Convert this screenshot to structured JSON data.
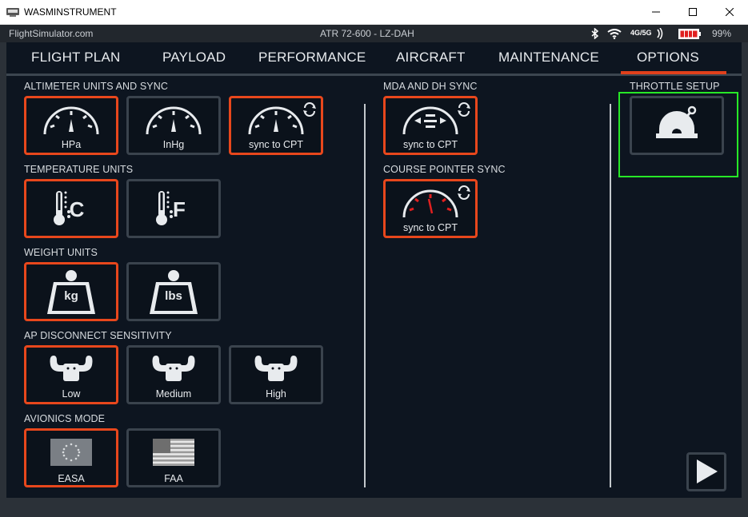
{
  "window": {
    "title": "WASMINSTRUMENT",
    "minimize_icon": "minimize-icon",
    "maximize_icon": "maximize-icon",
    "close_icon": "close-icon"
  },
  "status_bar": {
    "site": "FlightSimulator.com",
    "aircraft": "ATR 72-600 - LZ-DAH",
    "network": "4G/5G",
    "battery_percent": "99%",
    "icons": [
      "bluetooth-icon",
      "wifi-icon",
      "signal-icon",
      "battery-icon"
    ]
  },
  "tabs": [
    {
      "label": "FLIGHT PLAN"
    },
    {
      "label": "PAYLOAD"
    },
    {
      "label": "PERFORMANCE"
    },
    {
      "label": "AIRCRAFT"
    },
    {
      "label": "MAINTENANCE"
    },
    {
      "label": "OPTIONS"
    }
  ],
  "active_tab": "OPTIONS",
  "sections": {
    "altimeter": {
      "label": "ALTIMETER UNITS AND SYNC",
      "buttons": [
        {
          "caption": "HPa",
          "icon": "altimeter-gauge-icon",
          "selected": true
        },
        {
          "caption": "InHg",
          "icon": "altimeter-gauge-icon",
          "selected": false
        },
        {
          "caption": "sync to CPT",
          "icon": "altimeter-sync-icon",
          "selected": true
        }
      ]
    },
    "temperature": {
      "label": "TEMPERATURE UNITS",
      "buttons": [
        {
          "caption": "C",
          "icon": "thermometer-celsius-icon",
          "selected": true
        },
        {
          "caption": "F",
          "icon": "thermometer-fahrenheit-icon",
          "selected": false
        }
      ]
    },
    "weight": {
      "label": "WEIGHT UNITS",
      "buttons": [
        {
          "caption": "kg",
          "icon": "weight-kg-icon",
          "selected": true
        },
        {
          "caption": "lbs",
          "icon": "weight-lbs-icon",
          "selected": false
        }
      ]
    },
    "ap_disconnect": {
      "label": "AP DISCONNECT SENSITIVITY",
      "buttons": [
        {
          "caption": "Low",
          "icon": "yoke-icon",
          "selected": true
        },
        {
          "caption": "Medium",
          "icon": "yoke-icon",
          "selected": false
        },
        {
          "caption": "High",
          "icon": "yoke-icon",
          "selected": false
        }
      ]
    },
    "avionics": {
      "label": "AVIONICS MODE",
      "buttons": [
        {
          "caption": "EASA",
          "icon": "eu-flag-icon",
          "selected": true
        },
        {
          "caption": "FAA",
          "icon": "us-flag-icon",
          "selected": false
        }
      ]
    },
    "mda_dh": {
      "label": "MDA AND DH SYNC",
      "buttons": [
        {
          "caption": "sync to CPT",
          "icon": "mda-dh-sync-icon",
          "selected": true
        }
      ]
    },
    "course_pointer": {
      "label": "COURSE POINTER SYNC",
      "buttons": [
        {
          "caption": "sync to CPT",
          "icon": "course-pointer-sync-icon",
          "selected": true
        }
      ]
    },
    "throttle": {
      "label": "THROTTLE SETUP",
      "buttons": [
        {
          "caption": "",
          "icon": "throttle-lever-icon",
          "selected": false
        }
      ]
    }
  },
  "navigation": {
    "next_icon": "play-next-icon"
  },
  "colors": {
    "selected_border": "#e8471c",
    "unselected_border": "#3a434d",
    "highlight": "#27e827",
    "screen_bg": "#0d1520",
    "active_tab_underline": "#e0401c"
  }
}
